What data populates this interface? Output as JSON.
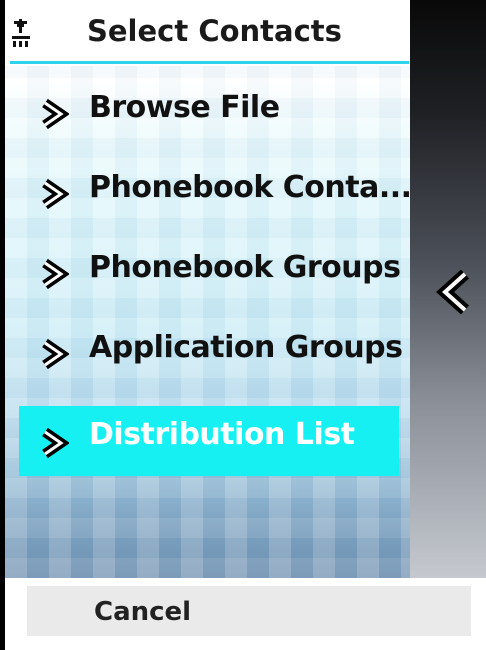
{
  "header": {
    "title": "Select Contacts",
    "status_icon": "signal-strength-icon"
  },
  "menu": {
    "items": [
      {
        "label": "Browse File",
        "icon": "chevron-right-icon",
        "selected": false
      },
      {
        "label": "Phonebook Conta...",
        "icon": "chevron-right-icon",
        "selected": false
      },
      {
        "label": "Phonebook Groups",
        "icon": "chevron-right-icon",
        "selected": false
      },
      {
        "label": "Application Groups",
        "icon": "chevron-right-icon",
        "selected": false
      },
      {
        "label": "Distribution List",
        "icon": "chevron-right-icon",
        "selected": true
      }
    ]
  },
  "side_panel": {
    "icon": "chevron-left-icon"
  },
  "softkeys": {
    "cancel_label": "Cancel"
  },
  "colors": {
    "accent": "#2fd3ec",
    "selection": "#17f0f2",
    "text": "#111111",
    "selected_text": "#ffffff"
  }
}
